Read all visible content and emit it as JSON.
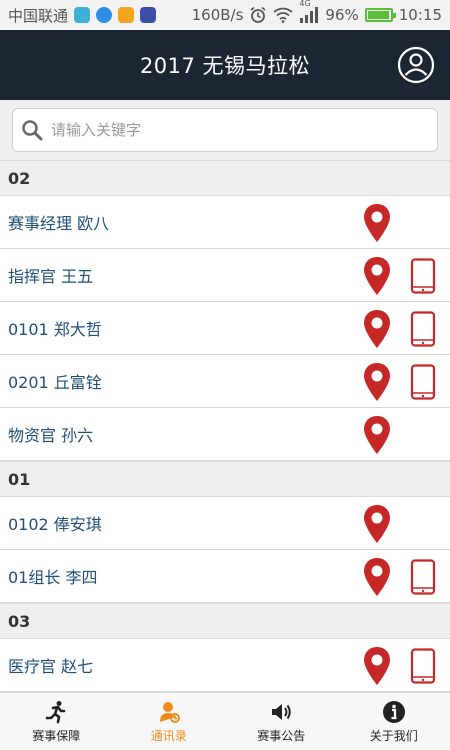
{
  "status_bar": {
    "carrier": "中国联通",
    "speed": "160B/s",
    "network": "4G",
    "battery": "96%",
    "battery_level": 0.96,
    "time": "10:15"
  },
  "header": {
    "title": "2017 无锡马拉松"
  },
  "search": {
    "placeholder": "请输入关键字",
    "value": ""
  },
  "groups": [
    {
      "label": "02",
      "rows": [
        {
          "label": "赛事经理 欧八",
          "phone": false
        },
        {
          "label": "指挥官 王五",
          "phone": true
        },
        {
          "label": "0101 郑大哲",
          "phone": true
        },
        {
          "label": "0201 丘富铨",
          "phone": true
        },
        {
          "label": "物资官 孙六",
          "phone": false
        }
      ]
    },
    {
      "label": "01",
      "rows": [
        {
          "label": "0102 俸安琪",
          "phone": false
        },
        {
          "label": "01组长 李四",
          "phone": true
        }
      ]
    },
    {
      "label": "03",
      "rows": [
        {
          "label": "医疗官 赵七",
          "phone": true
        }
      ]
    }
  ],
  "bottom_nav": [
    {
      "label": "赛事保障",
      "icon": "runner-icon",
      "active": false
    },
    {
      "label": "通讯录",
      "icon": "contacts-icon",
      "active": true
    },
    {
      "label": "赛事公告",
      "icon": "speaker-icon",
      "active": false
    },
    {
      "label": "关于我们",
      "icon": "info-icon",
      "active": false
    }
  ],
  "colors": {
    "header_bg": "#1c2633",
    "accent": "#f08a1a",
    "pin_red": "#c62828",
    "label_blue": "#1f4f7a"
  }
}
